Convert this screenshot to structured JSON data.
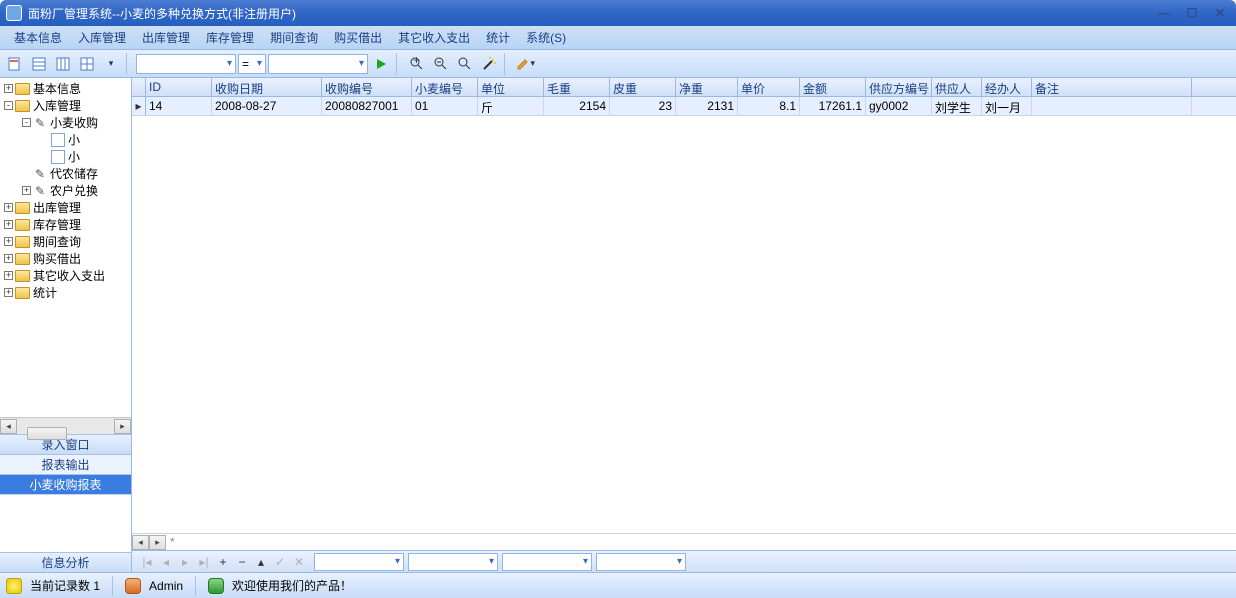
{
  "window": {
    "title": "面粉厂管理系统--小麦的多种兑换方式(非注册用户)"
  },
  "menu": {
    "items": [
      "基本信息",
      "入库管理",
      "出库管理",
      "库存管理",
      "期间查询",
      "购买借出",
      "其它收入支出",
      "统计",
      "系统(S)"
    ]
  },
  "toolbar": {
    "combo1": "",
    "combo2": "",
    "combo3": "="
  },
  "tree": {
    "items": [
      {
        "level": 0,
        "exp": "+",
        "icon": "folder",
        "label": "基本信息"
      },
      {
        "level": 0,
        "exp": "-",
        "icon": "folder",
        "label": "入库管理"
      },
      {
        "level": 1,
        "exp": "-",
        "icon": "wrench",
        "label": "小麦收购"
      },
      {
        "level": 2,
        "exp": "",
        "icon": "page",
        "label": "小"
      },
      {
        "level": 2,
        "exp": "",
        "icon": "page",
        "label": "小"
      },
      {
        "level": 1,
        "exp": "",
        "icon": "wrench",
        "label": "代农储存"
      },
      {
        "level": 1,
        "exp": "+",
        "icon": "wrench",
        "label": "农户兑换"
      },
      {
        "level": 0,
        "exp": "+",
        "icon": "folder",
        "label": "出库管理"
      },
      {
        "level": 0,
        "exp": "+",
        "icon": "folder",
        "label": "库存管理"
      },
      {
        "level": 0,
        "exp": "+",
        "icon": "folder",
        "label": "期间查询"
      },
      {
        "level": 0,
        "exp": "+",
        "icon": "folder",
        "label": "购买借出"
      },
      {
        "level": 0,
        "exp": "+",
        "icon": "folder",
        "label": "其它收入支出"
      },
      {
        "level": 0,
        "exp": "+",
        "icon": "folder",
        "label": "统计"
      }
    ]
  },
  "sidetabs": {
    "t1": "录入窗口",
    "t2": "报表输出",
    "t3": "小麦收购报表",
    "bottom": "信息分析"
  },
  "grid": {
    "headers": [
      "ID",
      "收购日期",
      "收购编号",
      "小麦编号",
      "单位",
      "毛重",
      "皮重",
      "净重",
      "单价",
      "金额",
      "供应方编号",
      "供应人",
      "经办人",
      "备注"
    ],
    "widths": [
      66,
      110,
      90,
      66,
      66,
      66,
      66,
      62,
      62,
      66,
      66,
      50,
      50,
      160
    ],
    "rows": [
      [
        "14",
        "2008-08-27",
        "20080827001",
        "01",
        "斤",
        "2154",
        "23",
        "2131",
        "8.1",
        "17261.1",
        "gy0002",
        "刘学生",
        "刘一月",
        ""
      ]
    ],
    "numericCols": [
      5,
      6,
      7,
      8,
      9
    ]
  },
  "status": {
    "records": "当前记录数 1",
    "user": "Admin",
    "welcome": "欢迎使用我们的产品！"
  }
}
